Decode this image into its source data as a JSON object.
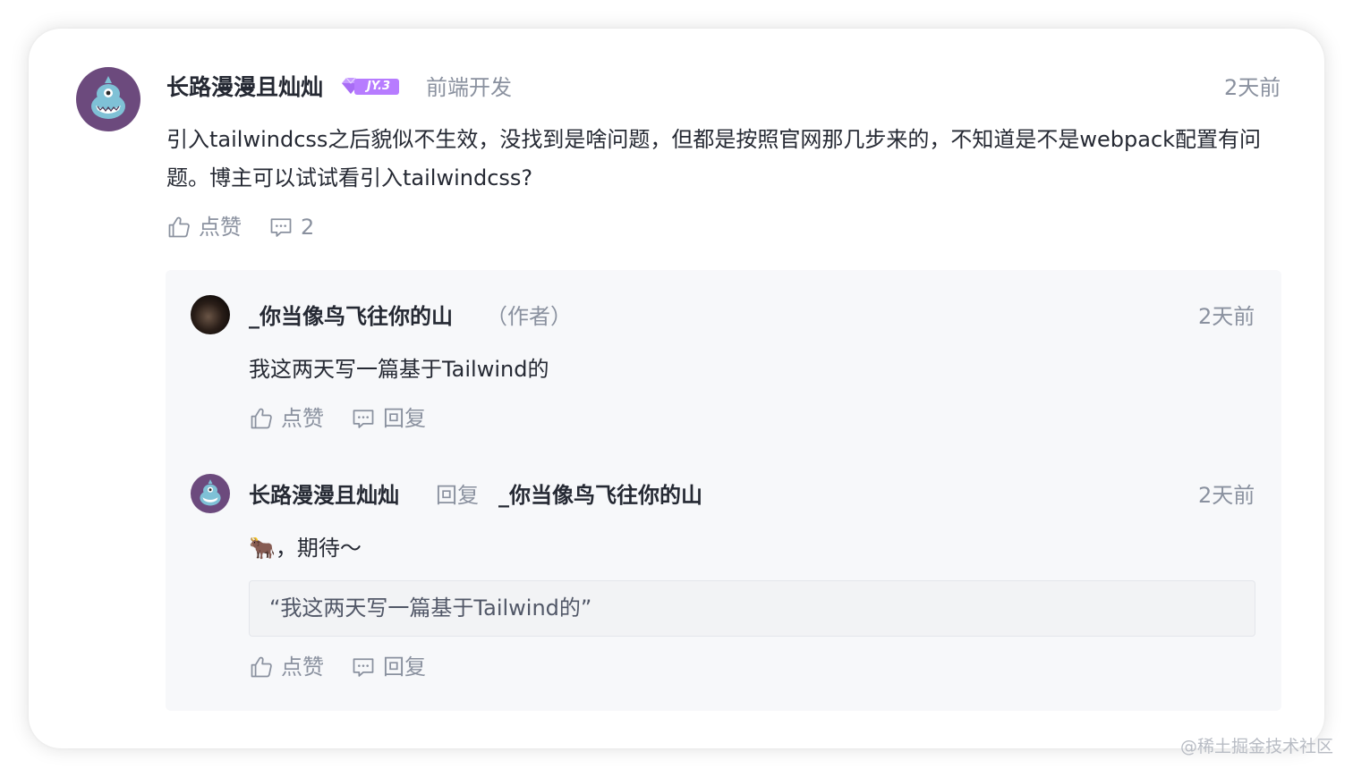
{
  "comment": {
    "author": "长路漫漫且灿灿",
    "level_badge": "JY.3",
    "job": "前端开发",
    "time": "2天前",
    "content": "引入tailwindcss之后貌似不生效，没找到是啥问题，但都是按照官网那几步来的，不知道是不是webpack配置有问题。博主可以试试看引入tailwindcss?",
    "like_label": "点赞",
    "reply_count": "2"
  },
  "replies": [
    {
      "author": "_你当像鸟飞往你的山",
      "author_tag": "（作者）",
      "time": "2天前",
      "content": "我这两天写一篇基于Tailwind的",
      "like_label": "点赞",
      "reply_label": "回复"
    },
    {
      "author": "长路漫漫且灿灿",
      "reply_word": "回复",
      "reply_to": "_你当像鸟飞往你的山",
      "time": "2天前",
      "content": "🐂，期待～",
      "quote": "“我这两天写一篇基于Tailwind的”",
      "like_label": "点赞",
      "reply_label": "回复"
    }
  ],
  "watermark": "@稀土掘金技术社区",
  "colors": {
    "badge": "#b77cff",
    "text_primary": "#252933",
    "text_secondary": "#8a919f",
    "reply_bg": "#f7f8fa"
  }
}
